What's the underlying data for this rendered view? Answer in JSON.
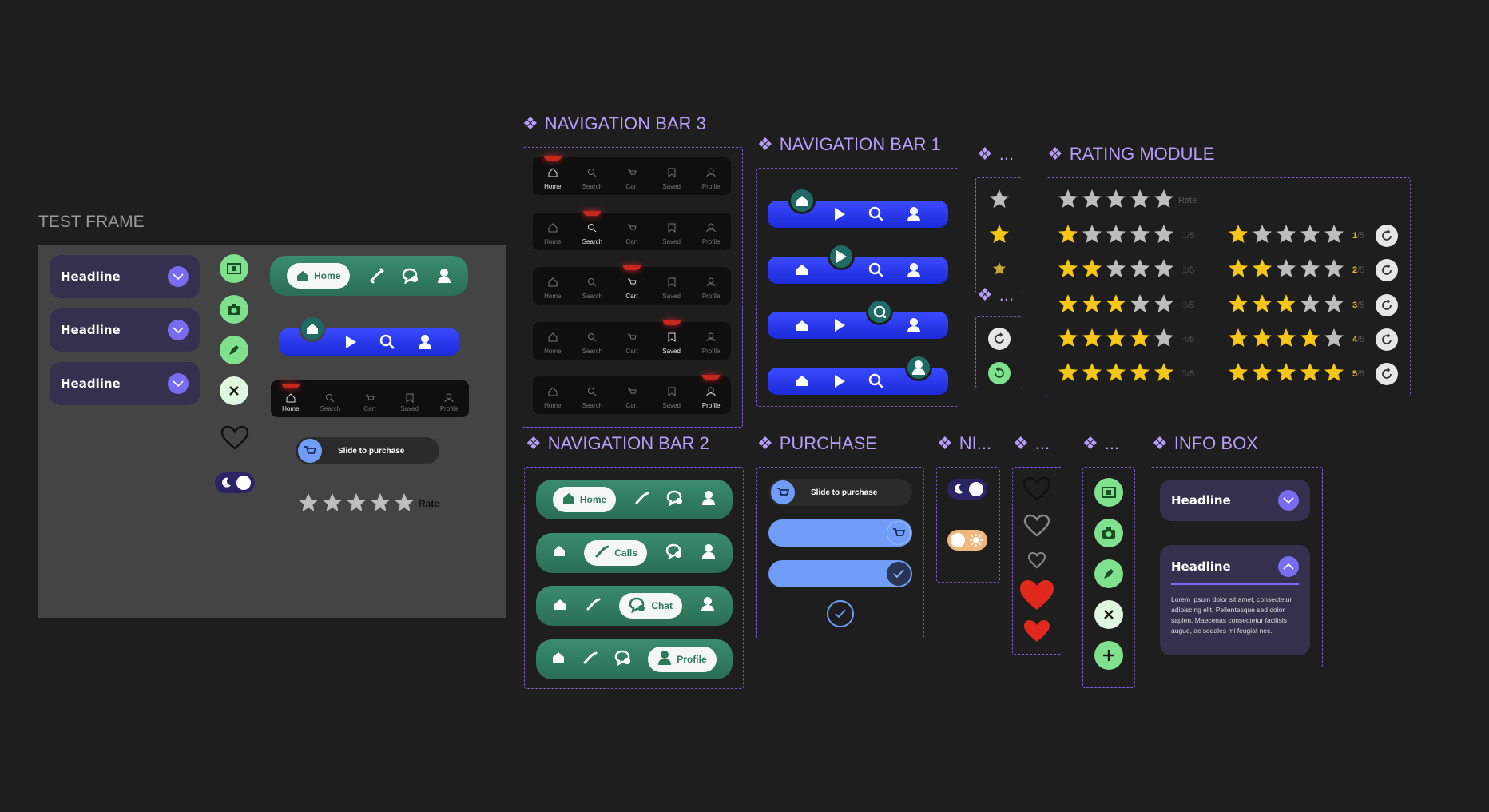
{
  "test_frame": {
    "title": "TEST FRAME",
    "headlines": [
      "Headline",
      "Headline",
      "Headline"
    ],
    "nav2_home_label": "Home",
    "slide_label": "Slide to purchase",
    "rate_label": "Rate",
    "nav3_labels": [
      "Home",
      "Search",
      "Cart",
      "Saved",
      "Profile"
    ]
  },
  "nav3": {
    "title": "NAVIGATION BAR 3",
    "labels": [
      "Home",
      "Search",
      "Cart",
      "Saved",
      "Profile"
    ]
  },
  "nav1": {
    "title": "NAVIGATION BAR 1"
  },
  "misc1_title": "...",
  "misc2_title": "...",
  "rating": {
    "title": "RATING MODULE",
    "rate_label": "Rate",
    "scores": [
      "1",
      "2",
      "3",
      "4",
      "5"
    ],
    "denom": "/5"
  },
  "nav2": {
    "title": "NAVIGATION BAR 2",
    "labels": [
      "Home",
      "Calls",
      "Chat",
      "Profile"
    ]
  },
  "purchase": {
    "title": "PURCHASE",
    "slide_label": "Slide to purchase"
  },
  "ni_title": "NI...",
  "hearts_title": "...",
  "buttons_title": "...",
  "info_box": {
    "title": "INFO BOX",
    "headline_collapsed": "Headline",
    "headline_expanded": "Headline",
    "body": "Lorem ipsum dolor sit amet, consectetur adipiscing elit. Pellentesque sed dolor sapien. Maecenas consectetur facilisis augue, ac sodales mi feugiat nec."
  },
  "colors": {
    "background": "#1e1e1e",
    "accent_purple": "#b69df8",
    "green": "#7fe08d",
    "nav_green": "#2f7a5e",
    "nav_blue": "#2536f0",
    "star_yellow": "#f5c518",
    "heart_red": "#e0281c"
  }
}
